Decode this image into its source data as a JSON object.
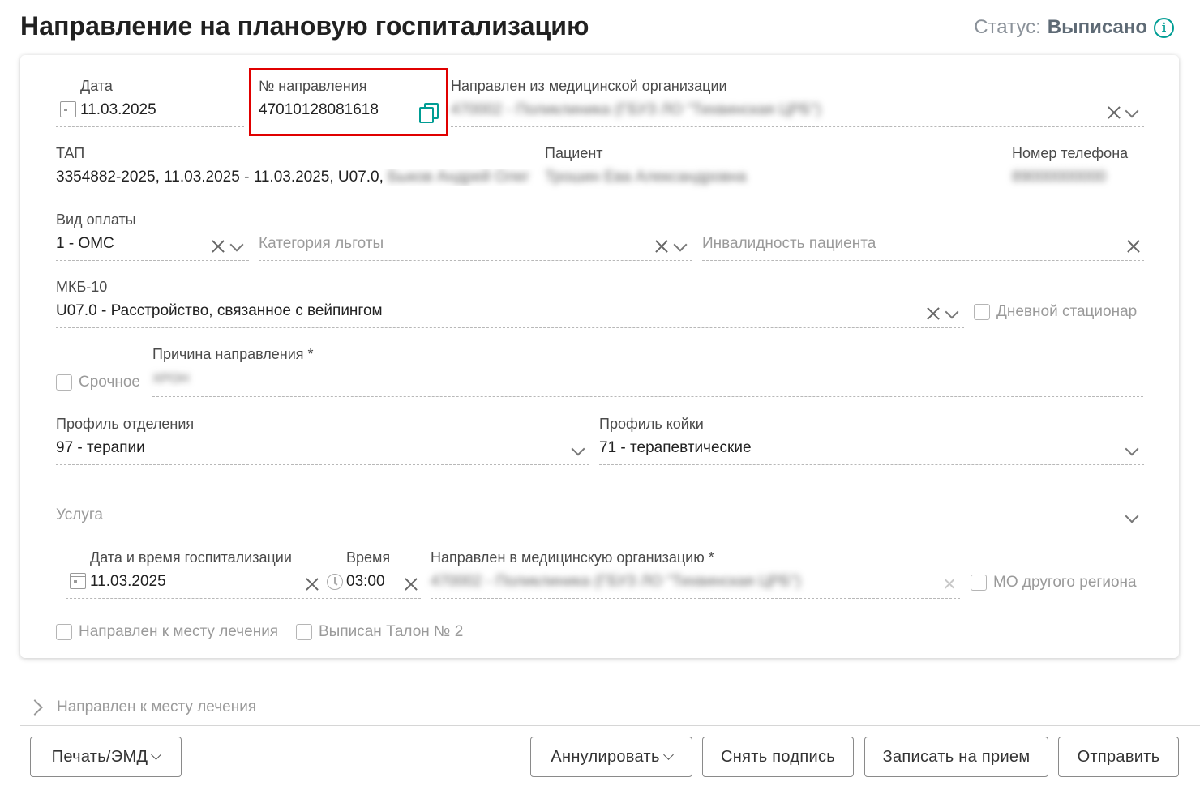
{
  "header": {
    "title": "Направление на плановую госпитализацию",
    "status_label": "Статус:",
    "status_value": "Выписано"
  },
  "form": {
    "date": {
      "label": "Дата",
      "value": "11.03.2025"
    },
    "referral_number": {
      "label": "№ направления",
      "value": "47010128081618"
    },
    "from_org": {
      "label": "Направлен из медицинской организации",
      "value": "470002 - Поликлиника (ГБУЗ ЛО \"Тихвинская ЦРБ\")"
    },
    "tap": {
      "label": "ТАП",
      "value": "3354882-2025, 11.03.2025 - 11.03.2025, U07.0,",
      "value_hidden": "Быков Андрей Олег"
    },
    "patient": {
      "label": "Пациент",
      "value": "Трошин Ева Александровна"
    },
    "phone": {
      "label": "Номер телефона",
      "value": "89000000000"
    },
    "payment": {
      "label": "Вид оплаты",
      "value": "1 - ОМС"
    },
    "benefit": {
      "placeholder": "Категория льготы"
    },
    "disability": {
      "placeholder": "Инвалидность пациента"
    },
    "mkb": {
      "label": "МКБ-10",
      "value": "U07.0 - Расстройство, связанное с вейпингом"
    },
    "day_hospital": {
      "label": "Дневной стационар"
    },
    "urgent": {
      "label": "Срочное"
    },
    "reason": {
      "label": "Причина направления *",
      "value": "ХРОН"
    },
    "dept_profile": {
      "label": "Профиль отделения",
      "value": "97 - терапии"
    },
    "bed_profile": {
      "label": "Профиль койки",
      "value": "71 - терапевтические"
    },
    "service": {
      "placeholder": "Услуга"
    },
    "hosp_date": {
      "label": "Дата и время госпитализации",
      "value": "11.03.2025"
    },
    "hosp_time": {
      "label": "Время",
      "value": "03:00"
    },
    "to_org": {
      "label": "Направлен в медицинскую организацию *",
      "value": "470002 - Поликлиника (ГБУЗ ЛО \"Тихвинская ЦРБ\")"
    },
    "other_region": {
      "label": "МО другого региона"
    },
    "to_treatment": {
      "label": "Направлен к месту лечения"
    },
    "talon2": {
      "label": "Выписан Талон № 2"
    }
  },
  "section": {
    "collapsed_label": "Направлен к месту лечения"
  },
  "footer": {
    "print": "Печать/ЭМД",
    "annul": "Аннулировать",
    "remove_sign": "Снять подпись",
    "appointment": "Записать на прием",
    "send": "Отправить"
  },
  "colors": {
    "accent": "#009d94",
    "highlight": "#e00000"
  }
}
